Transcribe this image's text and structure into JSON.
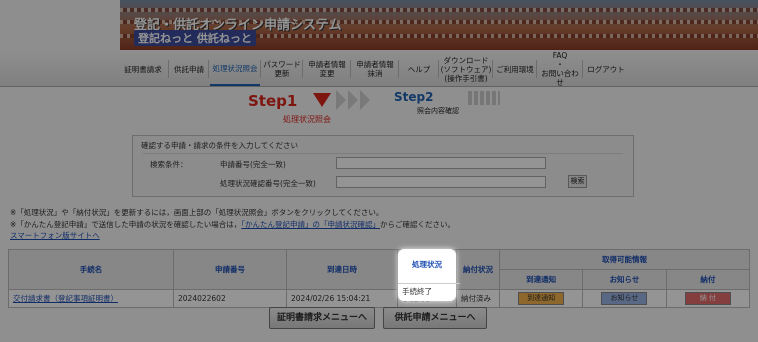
{
  "header": {
    "title": "登記・供託オンライン申請システム",
    "subtitle": "登記ねっと 供託ねっと"
  },
  "nav": {
    "items": [
      {
        "label": "証明書請求"
      },
      {
        "label": "供託申請"
      },
      {
        "label": "処理状況照会"
      },
      {
        "label": "パスワード\n更新"
      },
      {
        "label": "申請者情報\n変更"
      },
      {
        "label": "申請者情報\n抹消"
      },
      {
        "label": "ヘルプ"
      },
      {
        "label": "ダウンロード\n(ソフトウェア)\n(操作手引書)"
      },
      {
        "label": "ご利用環境"
      },
      {
        "label": "FAQ\n・\nお問い合わせ"
      },
      {
        "label": "ログアウト"
      }
    ]
  },
  "steps": {
    "step1": "Step1",
    "step1_label": "処理状況照会",
    "step2": "Step2",
    "step2_label": "照会内容確認"
  },
  "search": {
    "title": "確認する申請・請求の条件を入力してください",
    "condition_label": "検索条件：",
    "field1_label": "申請番号(完全一致)",
    "field2_label": "処理状況確認番号(完全一致)",
    "button": "検索"
  },
  "notices": {
    "line1": "※「処理状況」や「納付状況」を更新するには，画面上部の「処理状況照会」ボタンをクリックしてください。",
    "line2_prefix": "※「かんたん登記申請」で送信した申請の状況を確認したい場合は，",
    "line2_link": "「かんたん登記申請」の「申請状況確認」",
    "line2_suffix": "からご確認ください。",
    "smartphone_link": "スマートフォン版サイトへ"
  },
  "table": {
    "headers": {
      "procedure": "手続名",
      "app_number": "申請番号",
      "arrival": "到達日時",
      "status": "処理状況",
      "payment": "納付状況",
      "info": "取得可能情報",
      "arrival_notice": "到達通知",
      "notification": "お知らせ",
      "pay": "納付"
    },
    "row": {
      "procedure": "交付請求書（登記事項証明書）",
      "app_number": "2024022602",
      "arrival": "2024/02/26 15:04:21",
      "status": "手続終了",
      "payment": "納付済み",
      "arrival_notice_btn": "到達通知",
      "notification_btn": "お知らせ",
      "pay_btn": "納 付"
    }
  },
  "buttons": {
    "certificate_menu": "証明書請求メニューへ",
    "deposit_menu": "供託申請メニューへ"
  }
}
